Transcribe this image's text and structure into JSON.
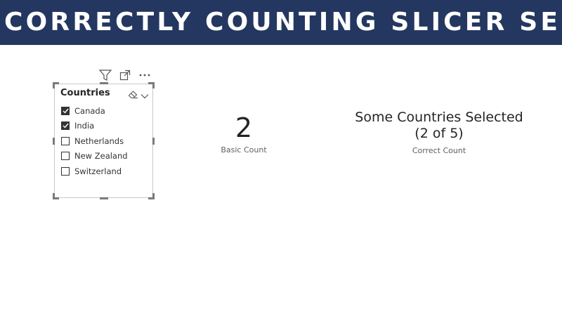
{
  "banner": {
    "title": "CORRECTLY COUNTING SLICER SELECTIONS"
  },
  "visual_header": {
    "icons": [
      "filter-icon",
      "focus-mode-icon",
      "more-options-icon"
    ]
  },
  "slicer": {
    "title": "Countries",
    "items": [
      {
        "label": "Canada",
        "checked": true
      },
      {
        "label": "India",
        "checked": true
      },
      {
        "label": "Netherlands",
        "checked": false
      },
      {
        "label": "New Zealand",
        "checked": false
      },
      {
        "label": "Switzerland",
        "checked": false
      }
    ]
  },
  "basic_card": {
    "value": "2",
    "label": "Basic Count"
  },
  "correct_card": {
    "line1": "Some Countries Selected",
    "line2": "(2 of 5)",
    "label": "Correct Count"
  },
  "colors": {
    "banner": "#243760",
    "text": "#252423",
    "muted": "#605e5c"
  }
}
